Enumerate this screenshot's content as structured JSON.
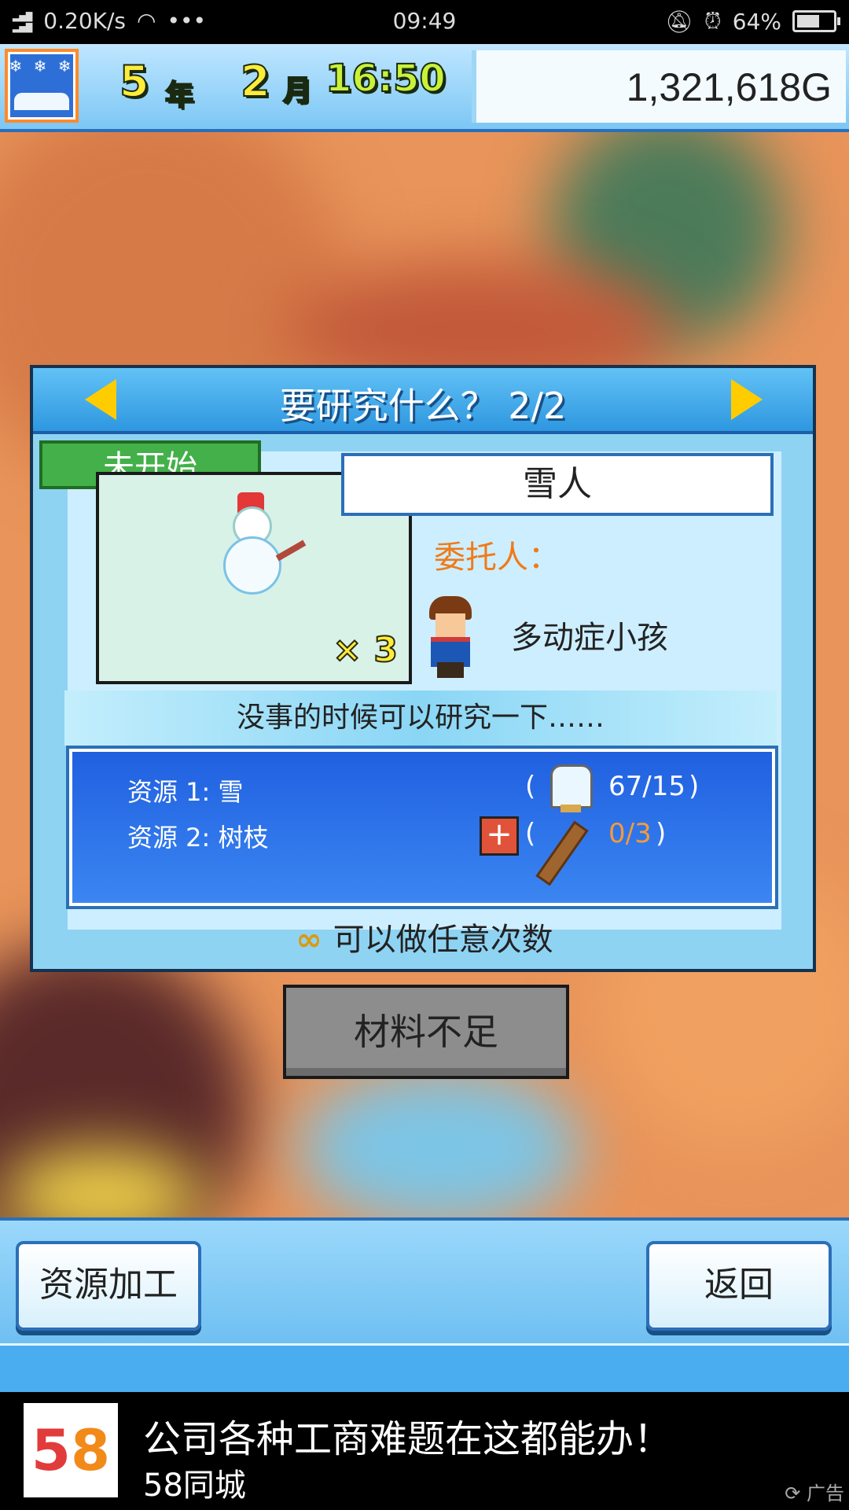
{
  "status_bar": {
    "network": "4G 2G",
    "speed": "0.20K/s",
    "more": "•••",
    "time": "09:49",
    "battery": "64%",
    "battery_level": 0.64
  },
  "topbar": {
    "year_num": "5",
    "year_unit": "年",
    "month_num": "2",
    "month_unit": "月",
    "clock": "16:50",
    "money": "1,321,618G"
  },
  "dialog": {
    "title": "要研究什么？ 2/2",
    "status_tab": "未开始",
    "item_name": "雪人",
    "multiplier": "× 3",
    "client_label": "委托人：",
    "client_name": "多动症小孩",
    "tip": "没事的时候可以研究一下……",
    "resources": [
      {
        "label": "资源 1: 雪",
        "count": "67/15",
        "count_color": "#ffffff"
      },
      {
        "label": "资源 2: 树枝",
        "count": "0/3",
        "count_color": "#f39a3c"
      }
    ],
    "paren_open": "(",
    "paren_close": ")",
    "plus": "+",
    "repeat_text": "可以做任意次数",
    "infinity_symbol": "∞"
  },
  "insufficient_button": "材料不足",
  "bottom": {
    "left_button": "资源加工",
    "right_button": "返回"
  },
  "ad": {
    "logo_5": "5",
    "logo_8": "8",
    "title": "公司各种工商难题在这都能办！",
    "subtitle": "58同城",
    "tag": "广告"
  },
  "colors": {
    "accent_blue": "#2b6fb8",
    "status_green": "#43b04a",
    "client_orange": "#f07a18"
  }
}
